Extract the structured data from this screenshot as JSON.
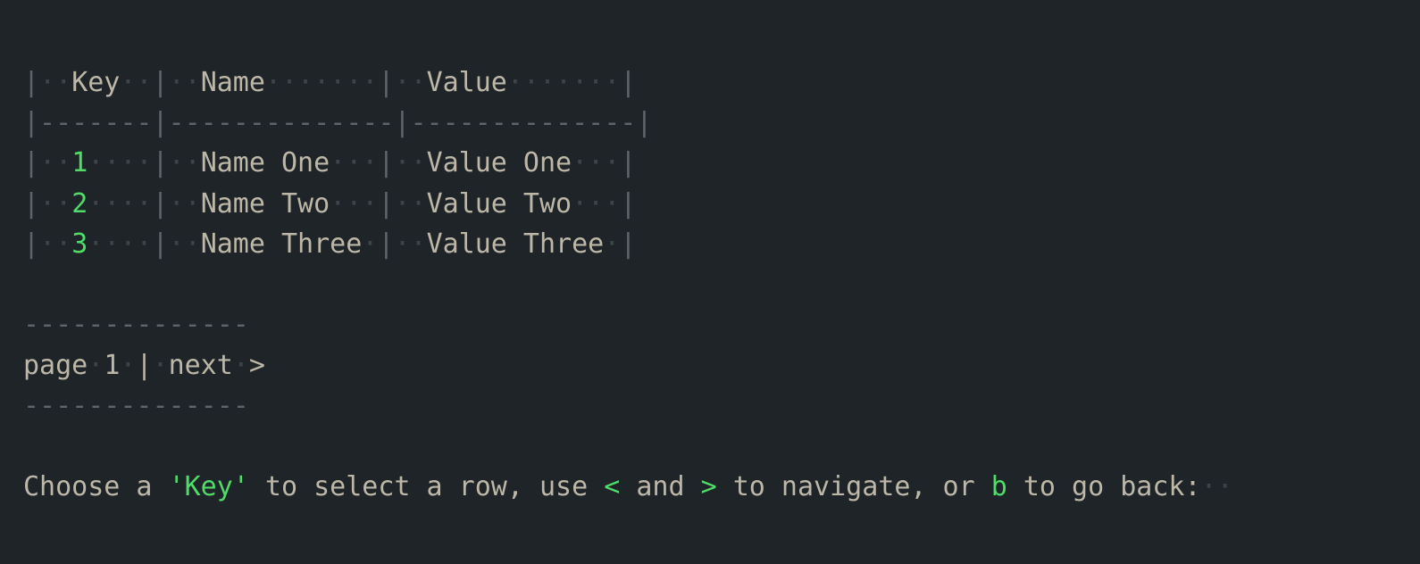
{
  "table": {
    "headers": [
      "Key",
      "Name",
      "Value"
    ],
    "rows": [
      {
        "key": "1",
        "name": "Name One",
        "value": "Value One"
      },
      {
        "key": "2",
        "name": "Name Two",
        "value": "Value Two"
      },
      {
        "key": "3",
        "name": "Name Three",
        "value": "Value Three"
      }
    ]
  },
  "pagination": {
    "divider": "--------------",
    "page_label": "page",
    "page_number": "1",
    "separator": "|",
    "next_label": "next",
    "next_arrow": ">"
  },
  "prompt": {
    "part1": "Choose a ",
    "key_word": "'Key'",
    "part2": " to select a row, use ",
    "prev_key": "<",
    "part3": " and ",
    "next_key": ">",
    "part4": " to navigate, or ",
    "back_key": "b",
    "part5": " to go back:"
  },
  "colors": {
    "background": "#1f2428",
    "text": "#bdb7a8",
    "accent": "#4fdc68",
    "muted": "#5d656c"
  }
}
